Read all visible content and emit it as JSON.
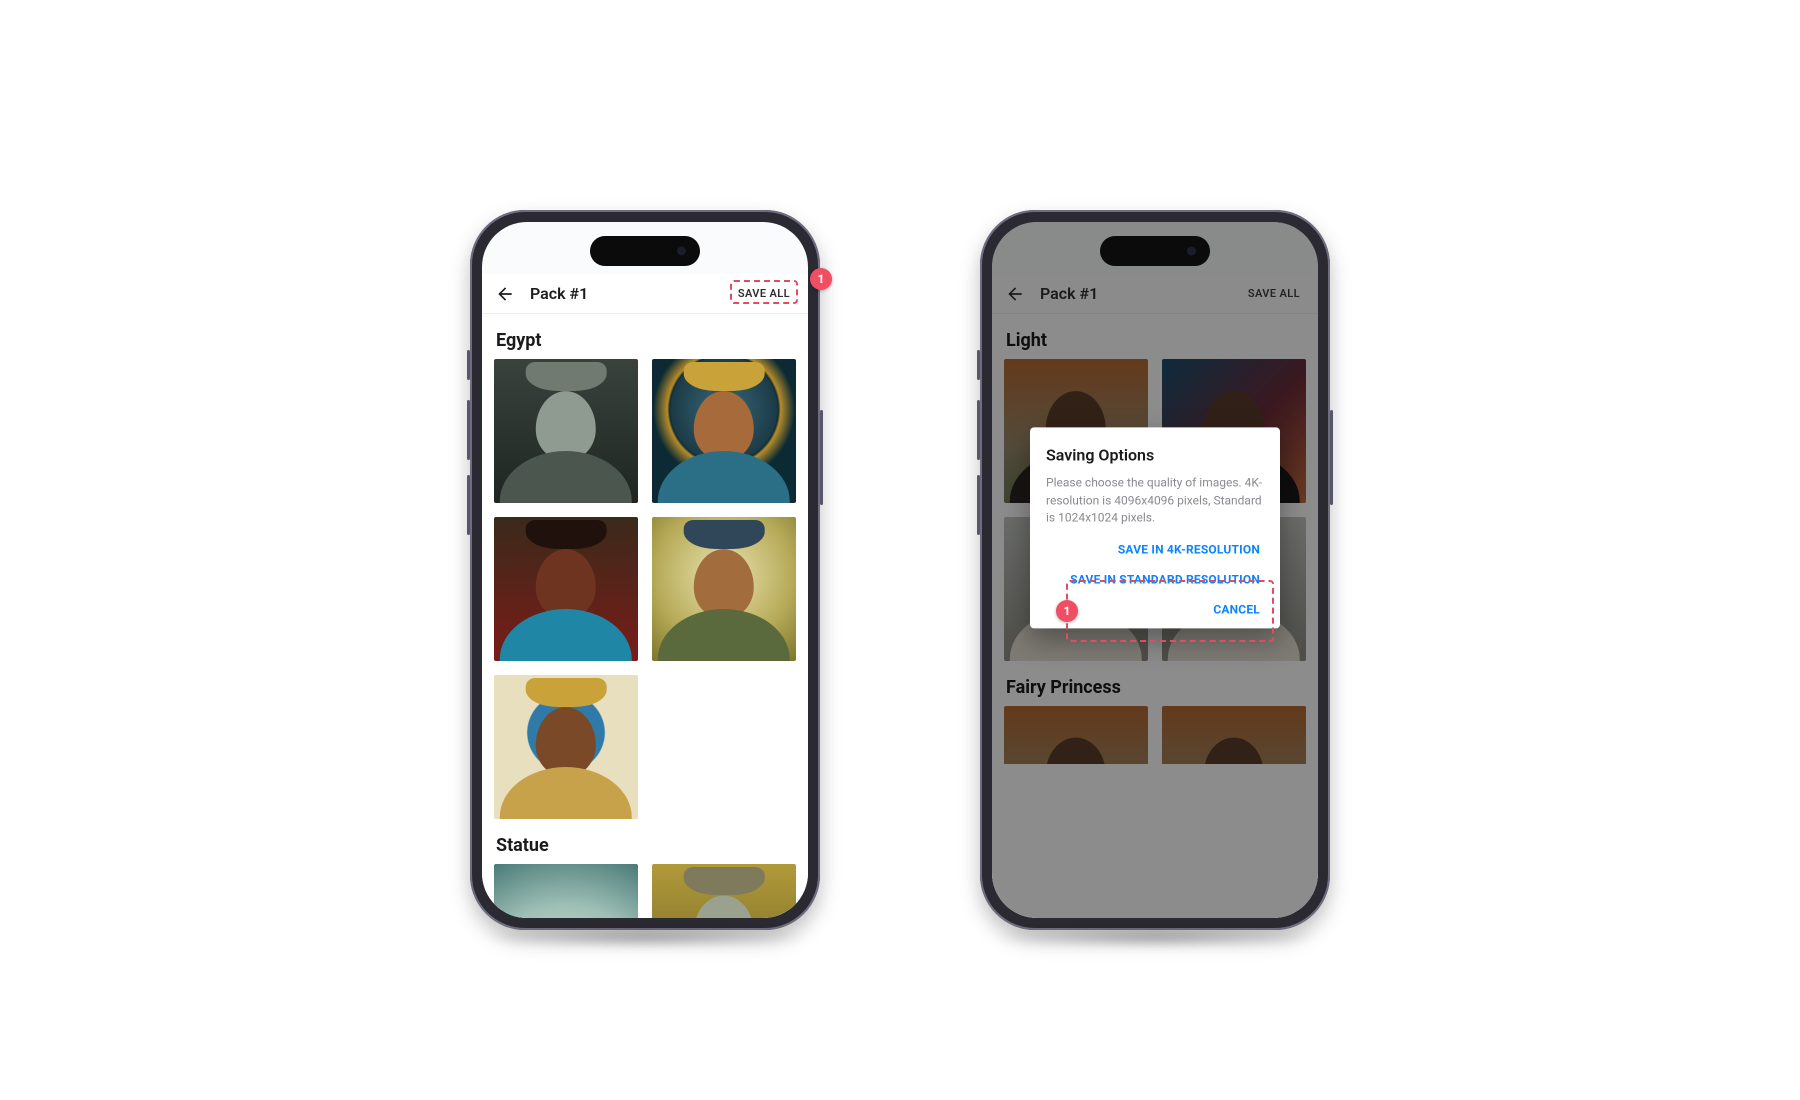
{
  "callouts": {
    "left": "1",
    "right": "1"
  },
  "screen1": {
    "appbar": {
      "title": "Pack #1",
      "save_all": "SAVE ALL"
    },
    "sections": [
      {
        "title": "Egypt",
        "images": [
          "eg1",
          "eg2",
          "eg3",
          "eg4",
          "eg5"
        ]
      },
      {
        "title": "Statue",
        "images": [
          "st1",
          "st2"
        ]
      }
    ]
  },
  "screen2": {
    "appbar": {
      "title": "Pack #1",
      "save_all": "SAVE ALL"
    },
    "sections": [
      {
        "title": "Light",
        "images": [
          "lt1",
          "lt2",
          "lt3",
          "lt3"
        ]
      },
      {
        "title": "Fairy Princess",
        "images": [
          "lt4",
          "lt4"
        ]
      }
    ],
    "dialog": {
      "title": "Saving Options",
      "body": "Please choose the quality of images. 4K-resolution is 4096x4096 pixels, Standard is 1024x1024 pixels.",
      "save_4k": "SAVE IN 4K-RESOLUTION",
      "save_standard": "SAVE IN STANDARD RESOLUTION",
      "cancel": "CANCEL"
    }
  }
}
